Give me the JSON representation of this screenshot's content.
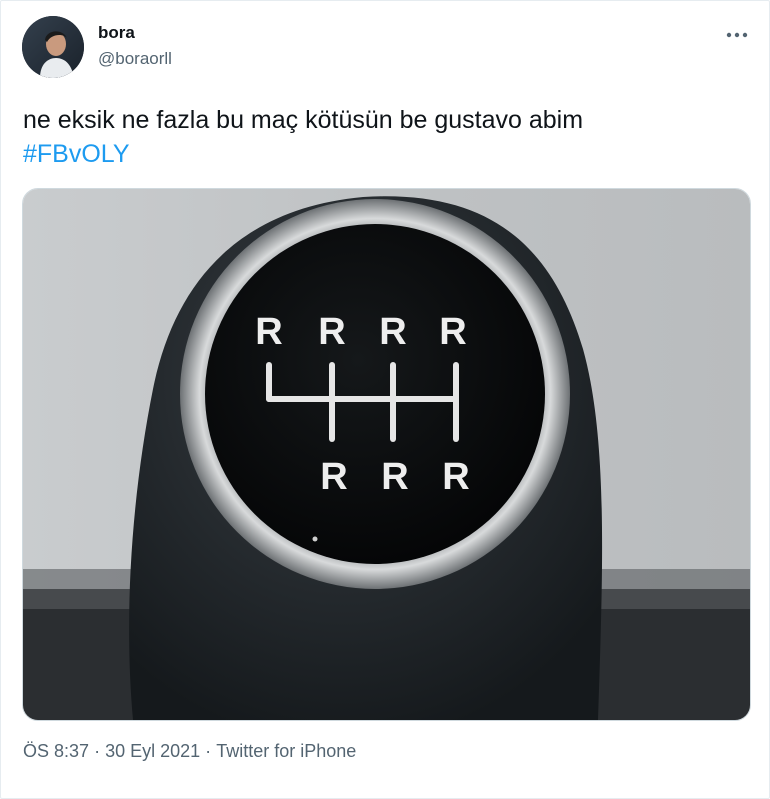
{
  "tweet": {
    "display_name": "bora",
    "handle": "@boraorll",
    "text": "ne eksik ne fazla bu maç kötüsün be gustavo abim",
    "hashtag": "#FBvOLY",
    "time": "ÖS 8:37",
    "date": "30 Eyl 2021",
    "separator": "·",
    "source": "Twitter for iPhone"
  },
  "media": {
    "knob_top_row": [
      "R",
      "R",
      "R",
      "R"
    ],
    "knob_bottom_row": [
      "R",
      "R",
      "R"
    ]
  },
  "icons": {
    "more": "more-dots-icon"
  },
  "colors": {
    "link": "#1d9bf0",
    "secondary_text": "#536471",
    "primary_text": "#0f1419"
  }
}
